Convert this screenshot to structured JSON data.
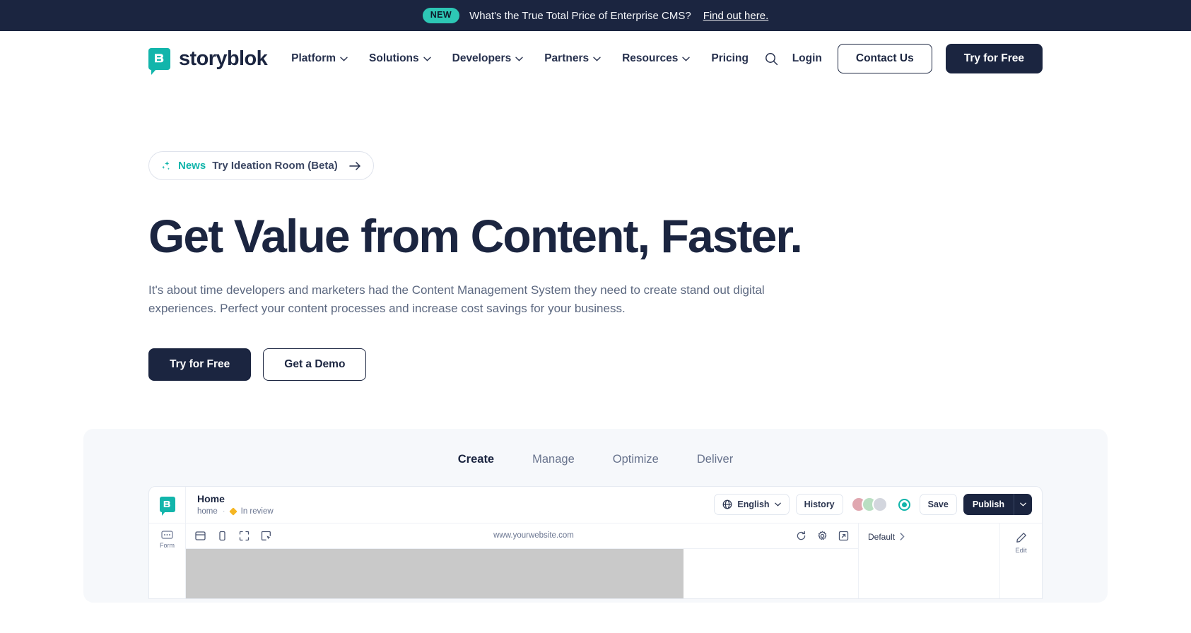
{
  "announcement": {
    "badge": "NEW",
    "text": "What's the True Total Price of Enterprise CMS?",
    "link_text": "Find out here."
  },
  "header": {
    "brand_name": "storyblok",
    "nav": [
      {
        "label": "Platform",
        "has_dropdown": true
      },
      {
        "label": "Solutions",
        "has_dropdown": true
      },
      {
        "label": "Developers",
        "has_dropdown": true
      },
      {
        "label": "Partners",
        "has_dropdown": true
      },
      {
        "label": "Resources",
        "has_dropdown": true
      },
      {
        "label": "Pricing",
        "has_dropdown": false
      }
    ],
    "search_icon": "search-icon",
    "login_label": "Login",
    "contact_label": "Contact Us",
    "try_label": "Try for Free"
  },
  "hero": {
    "pill": {
      "icon": "sparkles-icon",
      "label": "News",
      "text": "Try Ideation Room (Beta)",
      "arrow_icon": "arrow-right-icon"
    },
    "title": "Get Value from Content, Faster.",
    "subtitle": "It's about time developers and marketers had the Content Management System they need to create stand out digital experiences. Perfect your content processes and increase cost savings for your business.",
    "primary_cta": "Try for Free",
    "secondary_cta": "Get a Demo"
  },
  "showcase": {
    "tabs": [
      {
        "label": "Create",
        "active": true
      },
      {
        "label": "Manage",
        "active": false
      },
      {
        "label": "Optimize",
        "active": false
      },
      {
        "label": "Deliver",
        "active": false
      }
    ],
    "app": {
      "logo_icon": "storyblok-mark-icon",
      "page_title": "Home",
      "breadcrumb_slug": "home",
      "breadcrumb_separator": "·",
      "status_label": "In review",
      "status_color": "#f5b623",
      "language_label": "English",
      "language_icon": "globe-icon",
      "language_chevron": "chevron-down-icon",
      "history_label": "History",
      "save_label": "Save",
      "publish_label": "Publish",
      "publish_chevron": "chevron-down-icon",
      "presence_icon": "live-presence-icon",
      "avatars_count": 3,
      "sidebar_items": [
        {
          "icon": "form-icon",
          "label": "Form"
        }
      ],
      "device_icons": [
        "desktop-view-icon",
        "mobile-view-icon",
        "fullscreen-icon",
        "pointer-frame-icon"
      ],
      "url": "www.yourwebsite.com",
      "url_actions": [
        "refresh-icon",
        "settings-gear-icon",
        "open-external-icon"
      ],
      "right_panel_label": "Default",
      "right_panel_chevron": "chevron-right-icon",
      "edit_label": "Edit",
      "edit_icon": "pencil-icon"
    }
  },
  "colors": {
    "navy": "#1b2540",
    "teal": "#12b5ab",
    "badge_teal": "#2dc7b5",
    "muted_text": "#5c6880",
    "panel_bg": "#f6f8fb"
  }
}
